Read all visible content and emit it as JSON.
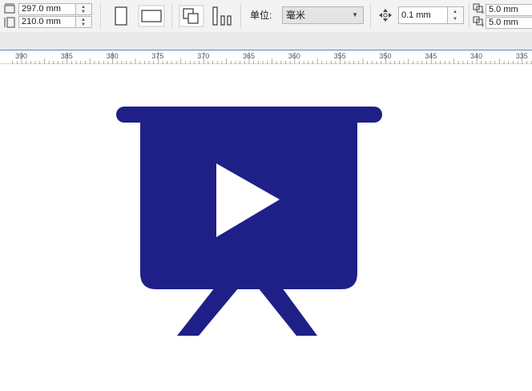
{
  "toolbar": {
    "page_width": "297.0 mm",
    "page_height": "210.0 mm",
    "units_label": "单位:",
    "units_value": "毫米",
    "nudge": "0.1 mm",
    "dup_x": "5.0 mm",
    "dup_y": "5.0 mm",
    "icons": {
      "portrait": "portrait-page-icon",
      "landscape": "landscape-page-icon",
      "all_pages": "all-pages-icon",
      "current_page": "current-page-icon",
      "nudge": "nudge-arrows-icon",
      "dup_distance": "duplicate-distance-icon"
    }
  },
  "ruler": {
    "labels": [
      "390",
      "385",
      "380",
      "375",
      "370",
      "365",
      "360",
      "355",
      "350",
      "345",
      "340",
      "335"
    ]
  },
  "canvas": {
    "icon": "presentation-play-icon",
    "icon_color": "#1e2087",
    "play_color": "#ffffff"
  }
}
